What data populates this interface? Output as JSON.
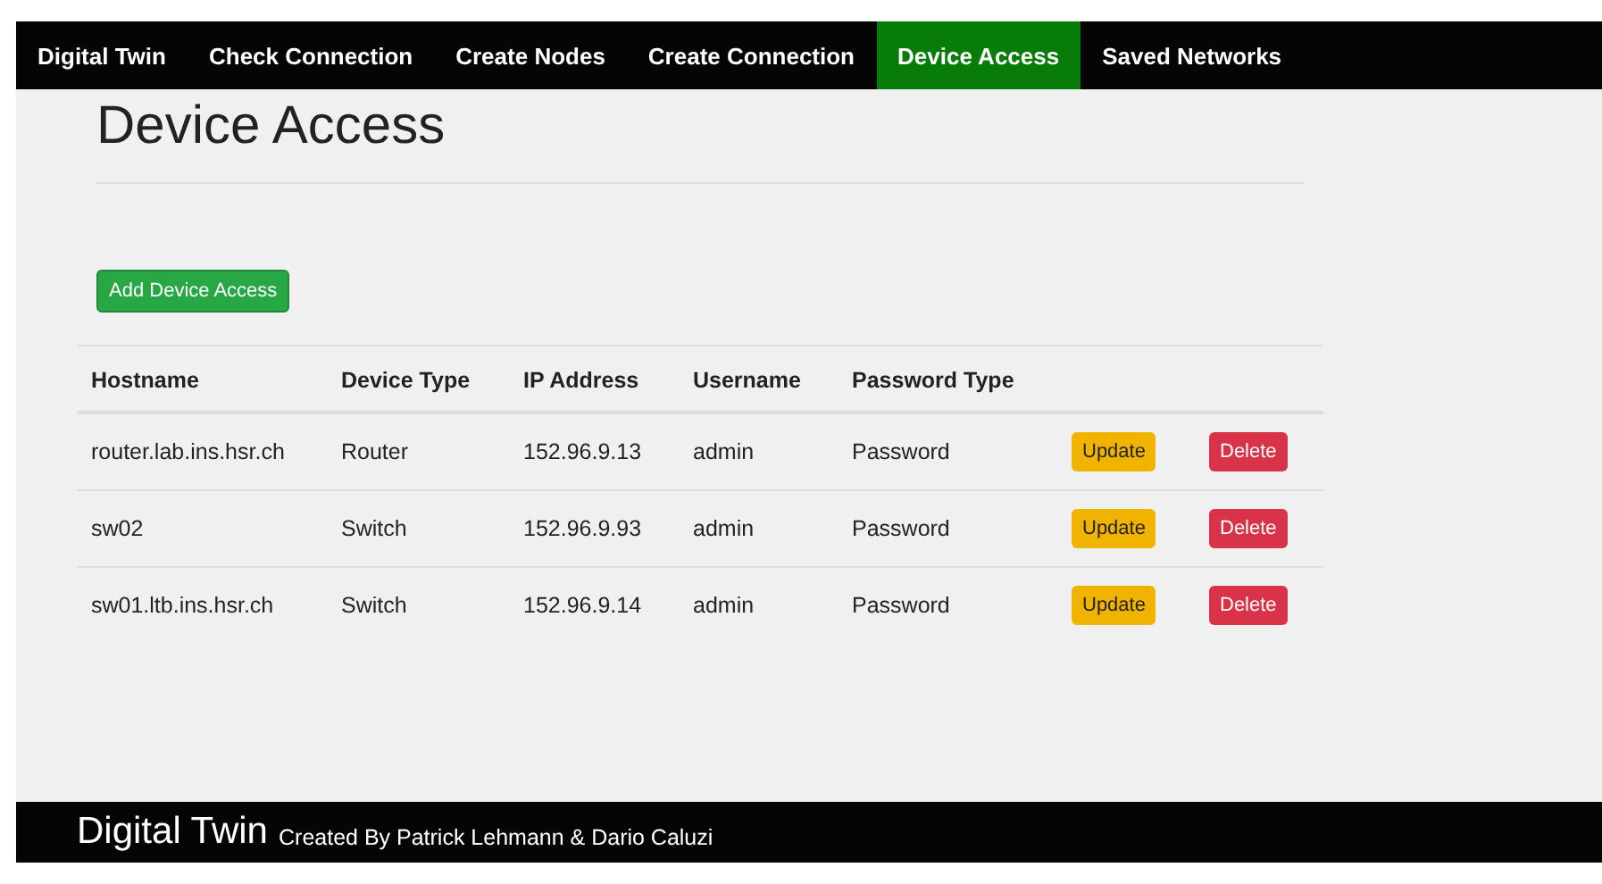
{
  "nav": {
    "items": [
      {
        "label": "Digital Twin",
        "selected": false
      },
      {
        "label": "Check Connection",
        "selected": false
      },
      {
        "label": "Create Nodes",
        "selected": false
      },
      {
        "label": "Create Connection",
        "selected": false
      },
      {
        "label": "Device Access",
        "selected": true
      },
      {
        "label": "Saved Networks",
        "selected": false
      }
    ]
  },
  "page": {
    "title": "Device Access",
    "add_button": "Add Device Access"
  },
  "table": {
    "columns": [
      "Hostname",
      "Device Type",
      "IP Address",
      "Username",
      "Password Type"
    ],
    "rows": [
      {
        "cells": [
          "router.lab.ins.hsr.ch",
          "Router",
          "152.96.9.13",
          "admin",
          "Password"
        ],
        "update": "Update",
        "delete": "Delete"
      },
      {
        "cells": [
          "sw02",
          "Switch",
          "152.96.9.93",
          "admin",
          "Password"
        ],
        "update": "Update",
        "delete": "Delete"
      },
      {
        "cells": [
          "sw01.ltb.ins.hsr.ch",
          "Switch",
          "152.96.9.14",
          "admin",
          "Password"
        ],
        "update": "Update",
        "delete": "Delete"
      }
    ]
  },
  "footer": {
    "brand": "Digital Twin",
    "credit": "Created By Patrick Lehmann & Dario Caluzi"
  }
}
